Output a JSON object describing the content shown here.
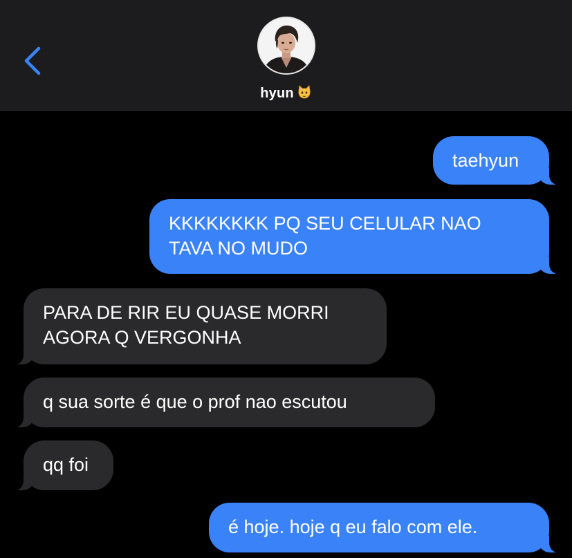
{
  "header": {
    "back_icon": "chevron-left-icon",
    "contact_name": "hyun",
    "contact_emoji": "cat-face-icon",
    "avatar_icon": "contact-avatar-photo"
  },
  "colors": {
    "header_bg": "#1c1c1e",
    "accent": "#3a82f7",
    "sent_bubble": "#3a82f7",
    "received_bubble": "#2a2a2c",
    "background": "#000000"
  },
  "messages": [
    {
      "direction": "sent",
      "lines": [
        "taehyun"
      ]
    },
    {
      "direction": "sent",
      "lines": [
        "KKKKKKKK PQ SEU CELULAR NAO",
        "TAVA NO MUDO"
      ]
    },
    {
      "direction": "received",
      "lines": [
        "PARA DE RIR EU QUASE MORRI",
        "AGORA Q VERGONHA"
      ]
    },
    {
      "direction": "received",
      "lines": [
        "q sua sorte é que o prof nao escutou"
      ]
    },
    {
      "direction": "received",
      "lines": [
        "qq foi"
      ]
    },
    {
      "direction": "sent",
      "lines": [
        "é hoje. hoje q eu falo com ele."
      ]
    }
  ]
}
